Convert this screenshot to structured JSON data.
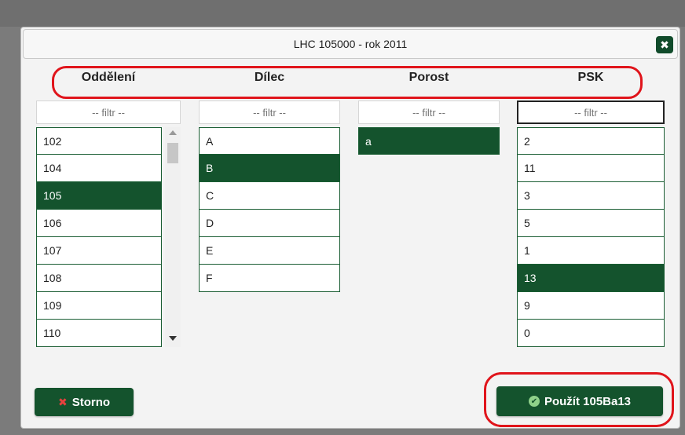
{
  "dialog": {
    "title": "LHC 105000 - rok 2011"
  },
  "columns": {
    "oddeleni": "Oddělení",
    "dilec": "Dílec",
    "porost": "Porost",
    "psk": "PSK"
  },
  "filter_placeholder": "-- filtr --",
  "lists": {
    "oddeleni": [
      "102",
      "104",
      "105",
      "106",
      "107",
      "108",
      "109",
      "110"
    ],
    "dilec": [
      "A",
      "B",
      "C",
      "D",
      "E",
      "F"
    ],
    "porost": [
      "a"
    ],
    "psk": [
      "2",
      "11",
      "3",
      "5",
      "1",
      "13",
      "9",
      "0"
    ]
  },
  "selected": {
    "oddeleni": "105",
    "dilec": "B",
    "porost": "a",
    "psk": "13"
  },
  "buttons": {
    "cancel": "Storno",
    "apply": "Použít 105Ba13"
  },
  "icons": {
    "close": "close-icon",
    "cancel": "x-icon",
    "apply": "check-circle-icon"
  },
  "colors": {
    "accent": "#14532d",
    "highlight": "#e0141b"
  }
}
